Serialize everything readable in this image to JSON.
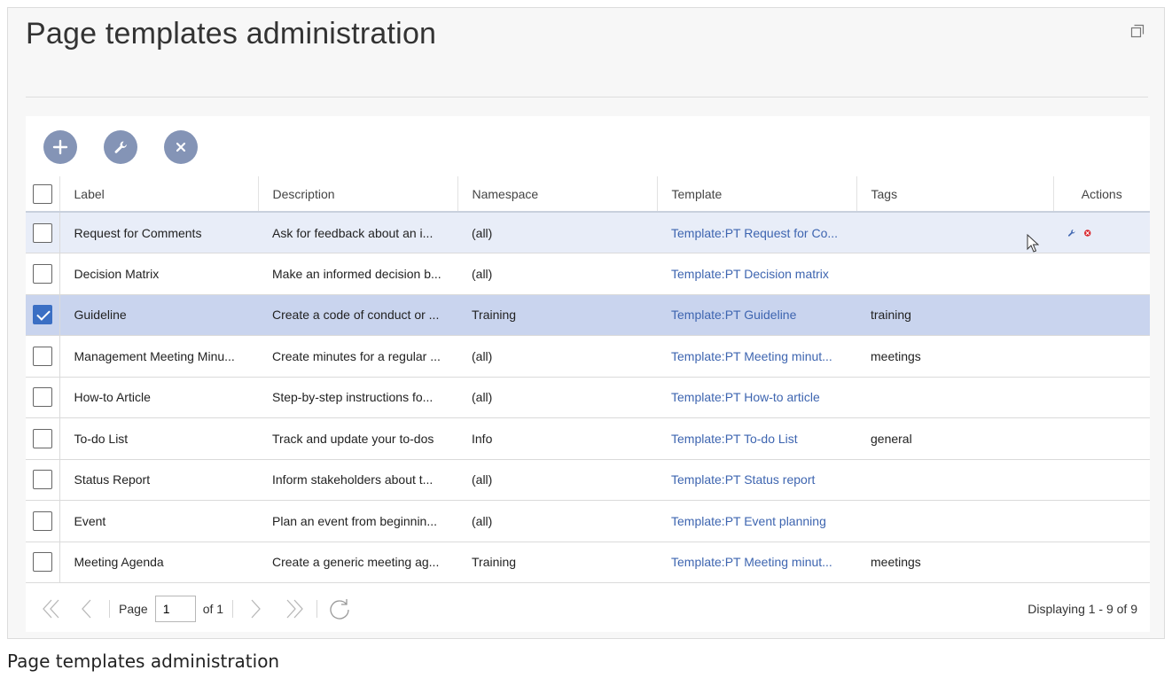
{
  "page": {
    "title": "Page templates administration",
    "caption": "Page templates administration"
  },
  "toolbar": {
    "add_icon": "plus-icon",
    "edit_icon": "wrench-icon",
    "delete_icon": "close-icon"
  },
  "grid": {
    "columns": [
      "Label",
      "Description",
      "Namespace",
      "Template",
      "Tags",
      "Actions"
    ],
    "rows": [
      {
        "label": "Request for Comments",
        "description": "Ask for feedback about an i...",
        "namespace": "(all)",
        "template": "Template:PT Request for Co...",
        "tags": "",
        "checked": false,
        "state": "hover"
      },
      {
        "label": "Decision Matrix",
        "description": "Make an informed decision b...",
        "namespace": "(all)",
        "template": "Template:PT Decision matrix",
        "tags": "",
        "checked": false,
        "state": ""
      },
      {
        "label": "Guideline",
        "description": "Create a code of conduct or ...",
        "namespace": "Training",
        "template": "Template:PT Guideline",
        "tags": "training",
        "checked": true,
        "state": "selected"
      },
      {
        "label": "Management Meeting Minu...",
        "description": "Create minutes for a regular ...",
        "namespace": "(all)",
        "template": "Template:PT Meeting minut...",
        "tags": "meetings",
        "checked": false,
        "state": ""
      },
      {
        "label": "How-to Article",
        "description": "Step-by-step instructions fo...",
        "namespace": "(all)",
        "template": "Template:PT How-to article",
        "tags": "",
        "checked": false,
        "state": ""
      },
      {
        "label": "To-do List",
        "description": "Track and update your to-dos",
        "namespace": "Info",
        "template": "Template:PT To-do List",
        "tags": "general",
        "checked": false,
        "state": ""
      },
      {
        "label": "Status Report",
        "description": "Inform stakeholders about t...",
        "namespace": "(all)",
        "template": "Template:PT Status report",
        "tags": "",
        "checked": false,
        "state": ""
      },
      {
        "label": "Event",
        "description": "Plan an event from beginnin...",
        "namespace": "(all)",
        "template": "Template:PT Event planning",
        "tags": "",
        "checked": false,
        "state": ""
      },
      {
        "label": "Meeting Agenda",
        "description": "Create a generic meeting ag...",
        "namespace": "Training",
        "template": "Template:PT Meeting minut...",
        "tags": "meetings",
        "checked": false,
        "state": ""
      }
    ]
  },
  "pager": {
    "page_label": "Page",
    "page_value": "1",
    "of_label": "of 1",
    "display_text": "Displaying 1 - 9 of 9"
  },
  "colors": {
    "accent": "#3e65b0",
    "toolbar_button": "#8494b6",
    "selected_row": "#c9d4ee",
    "hover_row": "#e8edf8",
    "delete_red": "#d9262c"
  }
}
